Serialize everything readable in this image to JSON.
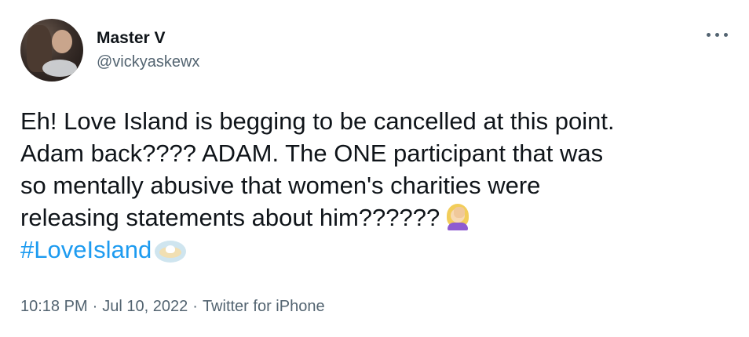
{
  "author": {
    "display_name": "Master V",
    "handle": "@vickyaskewx"
  },
  "tweet": {
    "lines": [
      "Eh! Love Island is begging to be cancelled at this point.",
      "Adam back???? ADAM. The ONE participant that was",
      "so mentally abusive that women's charities were",
      "releasing statements about him??????"
    ],
    "hashtag": "#LoveIsland",
    "emojis": [
      "woman-facepalming-icon",
      "love-island-hashtag-icon"
    ]
  },
  "meta": {
    "time": "10:18 PM",
    "separator": "·",
    "date": "Jul 10, 2022",
    "source": "Twitter for iPhone"
  },
  "colors": {
    "text": "#0f1419",
    "secondary": "#536471",
    "link": "#1d9bf0"
  },
  "icons": {
    "more": "more-options-icon"
  }
}
